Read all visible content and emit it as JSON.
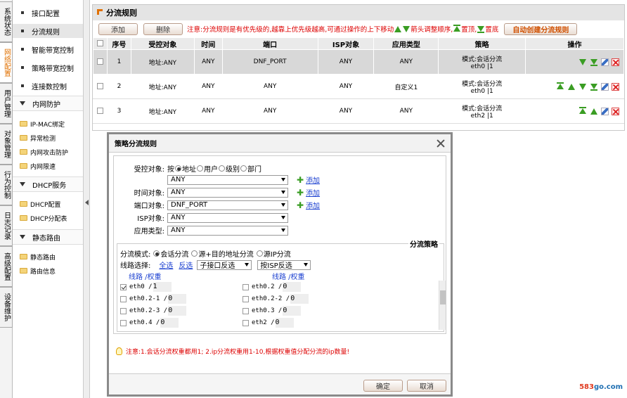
{
  "vtabs": [
    {
      "label": "系统状态",
      "active": false
    },
    {
      "label": "网络配置",
      "active": true
    },
    {
      "label": "用户管理",
      "active": false
    },
    {
      "label": "对象管理",
      "active": false
    },
    {
      "label": "行为控制",
      "active": false
    },
    {
      "label": "日志记录",
      "active": false
    },
    {
      "label": "高级配置",
      "active": false
    },
    {
      "label": "设备维护",
      "active": false
    }
  ],
  "sidebar": {
    "items": [
      "接口配置",
      "分流规则",
      "智能带宽控制",
      "策略带宽控制",
      "连接数控制"
    ],
    "sections": [
      {
        "title": "内网防护",
        "subs": [
          "IP-MAC绑定",
          "异常检测",
          "内网攻击防护",
          "内网限速"
        ]
      },
      {
        "title": "DHCP服务",
        "subs": [
          "DHCP配置",
          "DHCP分配表"
        ]
      },
      {
        "title": "静态路由",
        "subs": [
          "静态路由",
          "路由信息"
        ]
      }
    ]
  },
  "main": {
    "title": "分流规则",
    "add_label": "添加",
    "delete_label": "删除",
    "note_prefix": "注意:分流规则是有优先级的,越靠上优先级越高,可通过操作的上下移动",
    "note_mid": "箭头调整顺序,",
    "note_top": "置顶,",
    "note_bottom": "置底",
    "auto_create_label": "自动创建分流规则",
    "columns": [
      "序号",
      "受控对象",
      "时间",
      "端口",
      "ISP对象",
      "应用类型",
      "策略",
      "操作"
    ],
    "rows": [
      {
        "no": "1",
        "target": "地址:ANY",
        "time": "ANY",
        "port": "DNF_PORT",
        "isp": "ANY",
        "app": "ANY",
        "policy1": "模式:会话分流",
        "policy2": "eth0 |1"
      },
      {
        "no": "2",
        "target": "地址:ANY",
        "time": "ANY",
        "port": "ANY",
        "isp": "ANY",
        "app": "自定义1",
        "policy1": "模式:会话分流",
        "policy2": "eth0 |1"
      },
      {
        "no": "3",
        "target": "地址:ANY",
        "time": "ANY",
        "port": "ANY",
        "isp": "ANY",
        "app": "ANY",
        "policy1": "模式:会话分流",
        "policy2": "eth2 |1"
      }
    ]
  },
  "dialog": {
    "title": "策略分流规则",
    "controlled_label": "受控对象:",
    "by_label": "按",
    "radio_opts": [
      "地址",
      "用户",
      "级别",
      "部门"
    ],
    "sel1": "ANY",
    "time_label": "时间对象:",
    "time_val": "ANY",
    "port_label": "端口对象:",
    "port_val": "DNF_PORT",
    "isp_label": "ISP对象:",
    "isp_val": "ANY",
    "app_label": "应用类型:",
    "app_val": "ANY",
    "add_link": "添加",
    "fs_legend": "分流策略",
    "mode_label": "分流模式:",
    "mode_opts": [
      "会话分流",
      "源+目的地址分流",
      "源IP分流"
    ],
    "line_label": "线路选择:",
    "all": "全选",
    "invert": "反选",
    "sub_invert": "子接口反选",
    "isp_invert": "按ISP反选",
    "col_header": "线路 /权重",
    "links_left": [
      {
        "name": "eth0 /",
        "w": "1",
        "checked": true
      },
      {
        "name": "eth0.2-1 /",
        "w": "0",
        "checked": false
      },
      {
        "name": "eth0.2-3 /",
        "w": "0",
        "checked": false
      },
      {
        "name": "eth0.4 /",
        "w": "0",
        "checked": false
      }
    ],
    "links_right": [
      {
        "name": "eth0.2 /",
        "w": "0",
        "checked": false
      },
      {
        "name": "eth0.2-2 /",
        "w": "0",
        "checked": false
      },
      {
        "name": "eth0.3 /",
        "w": "0",
        "checked": false
      },
      {
        "name": "eth2 /",
        "w": "0",
        "checked": false
      }
    ],
    "tip": "注意:1.会话分流权重都用1; 2.ip分流权重用1-10,根据权重值分配分流的ip数量!",
    "ok": "确定",
    "cancel": "取消"
  },
  "watermark": {
    "pre": "583",
    "post": "go.com"
  }
}
